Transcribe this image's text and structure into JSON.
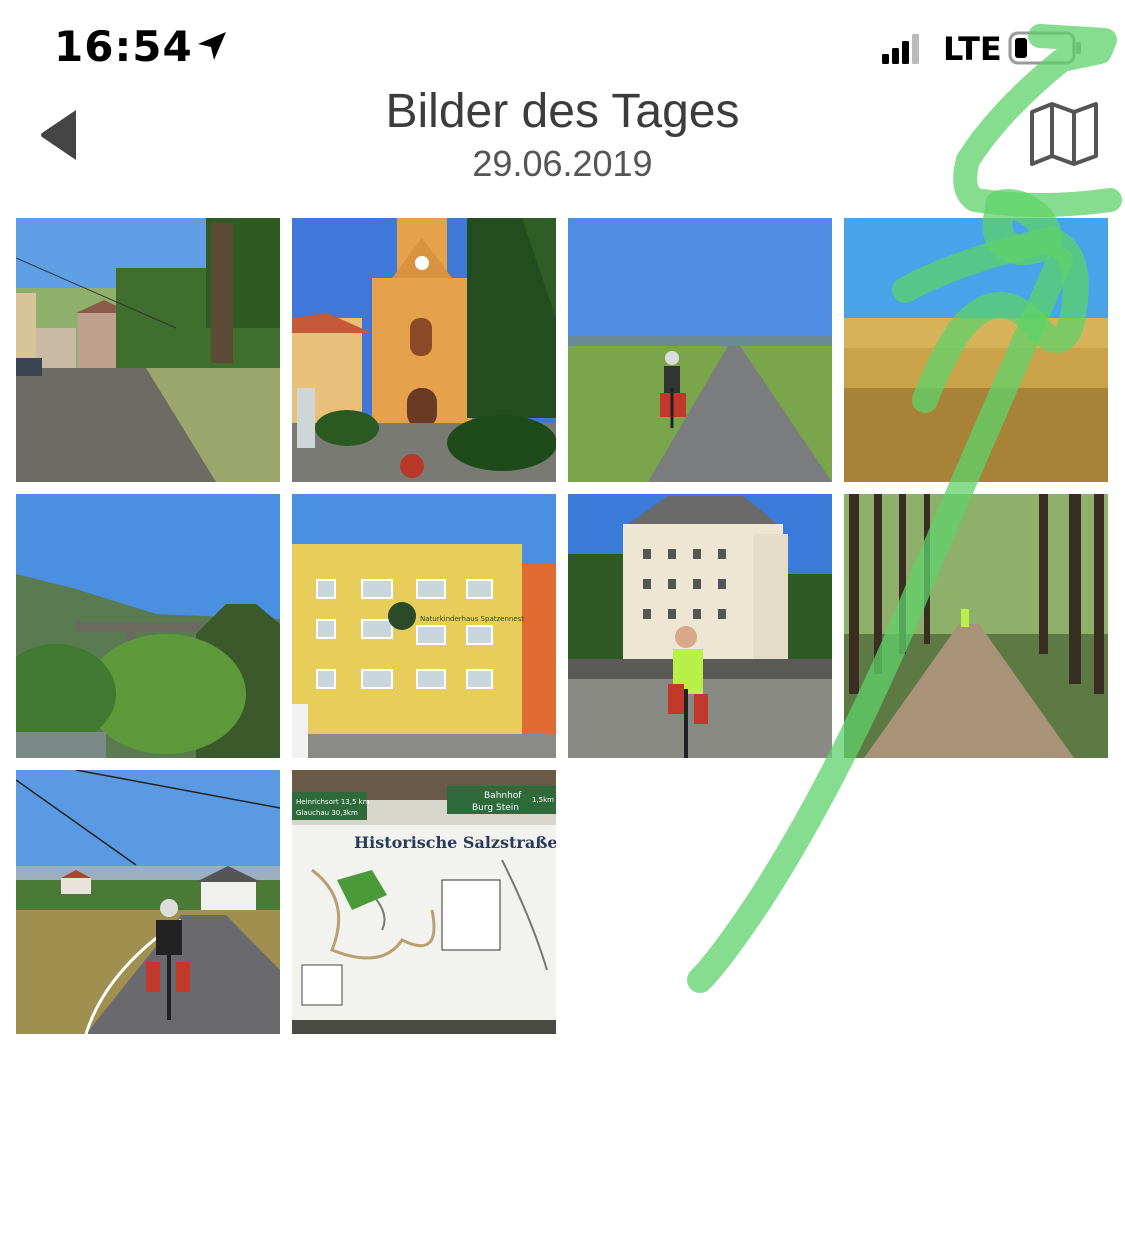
{
  "status_bar": {
    "time": "16:54",
    "network": "LTE",
    "icons": [
      "location-arrow-icon",
      "signal-bars-icon",
      "battery-icon"
    ]
  },
  "nav": {
    "title": "Bilder des Tages",
    "date": "29.06.2019",
    "back_icon": "back-chevron-icon",
    "map_icon": "map-icon"
  },
  "photos": [
    {
      "name": "village-road"
    },
    {
      "name": "church-tower"
    },
    {
      "name": "cyclist-rural-road"
    },
    {
      "name": "wheat-field"
    },
    {
      "name": "viaduct-valley"
    },
    {
      "name": "yellow-building"
    },
    {
      "name": "castle-cyclist"
    },
    {
      "name": "forest-path"
    },
    {
      "name": "cyclist-hill-road"
    },
    {
      "name": "salt-route-sign"
    }
  ],
  "photo_texts": {
    "sign_title": "Historische Salzstraße",
    "sign_left_1": "Heinrichsort 13,5 km",
    "sign_left_2": "Glauchau 30,3km",
    "sign_right_1": "Bahnhof",
    "sign_right_2": "Burg Stein",
    "sign_right_km": "1,5km",
    "building_sign": "Naturkinderhaus Spatzennest"
  },
  "colors": {
    "title": "#3c3c3c",
    "scribble": "#5fd16a"
  }
}
